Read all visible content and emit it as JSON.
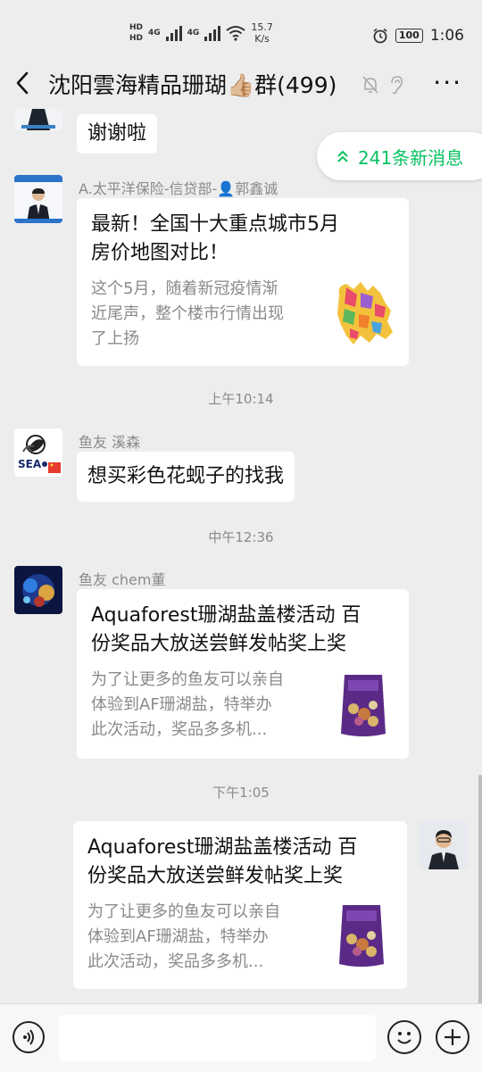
{
  "status_bar": {
    "hd_top": "HD",
    "hd_bottom": "HD",
    "sim1": "4G",
    "sim2": "4G",
    "speed_value": "15.7",
    "speed_unit": "K/s",
    "battery": "100",
    "time": "1:06",
    "icons": [
      "signal-icon",
      "wifi-icon",
      "alarm-icon",
      "battery-icon"
    ]
  },
  "header": {
    "title": "沈阳雲海精品珊瑚👍🏼群(499)",
    "icons": [
      "back-icon",
      "mute-icon",
      "ear-icon",
      "more-icon"
    ],
    "more_label": "···"
  },
  "new_messages": {
    "label": "241条新消息",
    "arrow": "≈"
  },
  "messages": [
    {
      "type": "text",
      "text": "谢谢啦"
    },
    {
      "type": "card",
      "sender": "A.太平洋保险-信贷部-👤郭鑫诚",
      "title_line1": "最新！全国十大重点城市5月",
      "title_line2": "房价地图对比！",
      "desc_line1": "这个5月，随着新冠疫情渐",
      "desc_line2": "近尾声，整个楼市行情出现",
      "desc_line3": "了上扬"
    },
    {
      "type": "time",
      "text": "上午10:14"
    },
    {
      "type": "text",
      "sender": "鱼友 溪森",
      "text": "想买彩色花蚬子的找我"
    },
    {
      "type": "time",
      "text": "中午12:36"
    },
    {
      "type": "card",
      "sender": "鱼友 chem董",
      "title_line1": "Aquaforest珊湖盐盖楼活动 百",
      "title_line2": "份奖品大放送尝鲜发帖奖上奖",
      "desc_line1": "为了让更多的鱼友可以亲自",
      "desc_line2": "体验到AF珊湖盐，特举办",
      "desc_line3": "此次活动，奖品多多机..."
    },
    {
      "type": "time",
      "text": "下午1:05"
    },
    {
      "type": "card",
      "self": true,
      "title_line1": "Aquaforest珊湖盐盖楼活动 百",
      "title_line2": "份奖品大放送尝鲜发帖奖上奖",
      "desc_line1": "为了让更多的鱼友可以亲自",
      "desc_line2": "体验到AF珊湖盐，特举办",
      "desc_line3": "此次活动，奖品多多机..."
    }
  ],
  "colors": {
    "accent": "#07c160",
    "background": "#ededed",
    "bubble": "#ffffff",
    "muted_text": "#8a8a8a"
  },
  "input_bar": {
    "icons": [
      "voice-icon",
      "emoji-icon",
      "plus-icon"
    ],
    "placeholder": ""
  }
}
